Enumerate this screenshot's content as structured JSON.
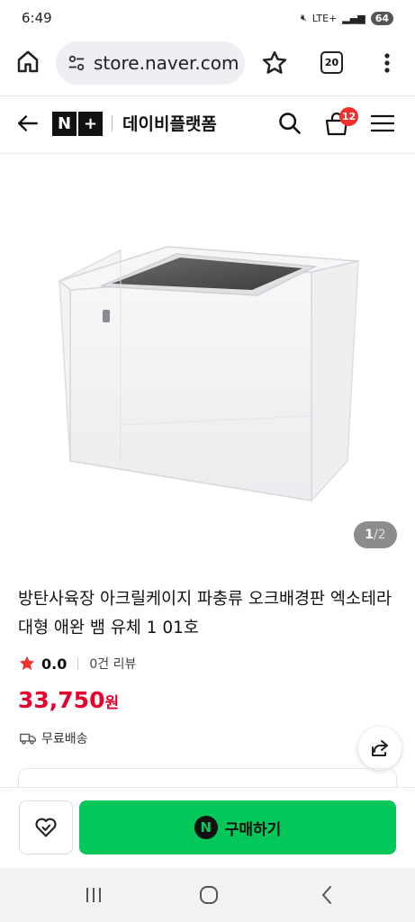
{
  "status_bar": {
    "time": "6:49",
    "signal_label": "LTE+",
    "battery": "64"
  },
  "browser": {
    "url": "store.naver.com",
    "tab_count": "20"
  },
  "site_header": {
    "logo_n": "N",
    "logo_plus": "+",
    "brand": "데이비플랫폼",
    "cart_count": "12"
  },
  "gallery": {
    "current": "1",
    "separator": " / ",
    "total": "2"
  },
  "product": {
    "title": "방탄사육장 아크릴케이지 파충류 오크배경판 엑소테라 대형 애완 뱀 유체 1 01호",
    "rating": "0.0",
    "review_count": "0건 리뷰",
    "price": "33,750",
    "price_unit": "원",
    "shipping": "무료배송"
  },
  "bottom_bar": {
    "buy_label": "구매하기",
    "npay_letter": "N"
  },
  "colors": {
    "price": "#e6002b",
    "buy_button": "#03c75a",
    "cart_badge": "#f2312f",
    "rating_star": "#f2312f"
  }
}
